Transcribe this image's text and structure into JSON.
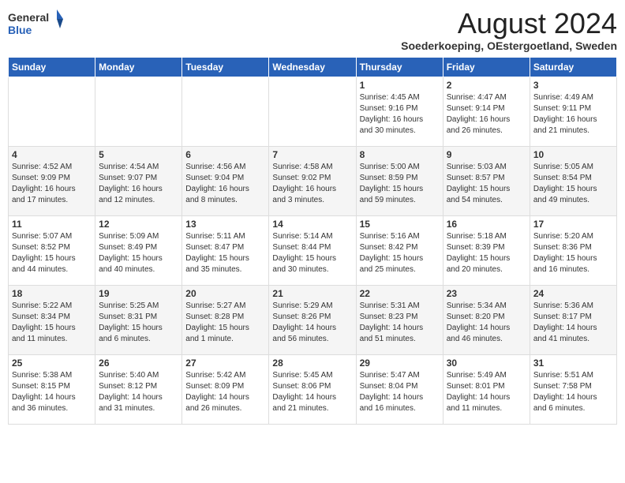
{
  "header": {
    "logo_general": "General",
    "logo_blue": "Blue",
    "title": "August 2024",
    "subtitle": "Soederkoeping, OEstergoetland, Sweden"
  },
  "days_of_week": [
    "Sunday",
    "Monday",
    "Tuesday",
    "Wednesday",
    "Thursday",
    "Friday",
    "Saturday"
  ],
  "weeks": [
    [
      {
        "num": "",
        "info": ""
      },
      {
        "num": "",
        "info": ""
      },
      {
        "num": "",
        "info": ""
      },
      {
        "num": "",
        "info": ""
      },
      {
        "num": "1",
        "info": "Sunrise: 4:45 AM\nSunset: 9:16 PM\nDaylight: 16 hours\nand 30 minutes."
      },
      {
        "num": "2",
        "info": "Sunrise: 4:47 AM\nSunset: 9:14 PM\nDaylight: 16 hours\nand 26 minutes."
      },
      {
        "num": "3",
        "info": "Sunrise: 4:49 AM\nSunset: 9:11 PM\nDaylight: 16 hours\nand 21 minutes."
      }
    ],
    [
      {
        "num": "4",
        "info": "Sunrise: 4:52 AM\nSunset: 9:09 PM\nDaylight: 16 hours\nand 17 minutes."
      },
      {
        "num": "5",
        "info": "Sunrise: 4:54 AM\nSunset: 9:07 PM\nDaylight: 16 hours\nand 12 minutes."
      },
      {
        "num": "6",
        "info": "Sunrise: 4:56 AM\nSunset: 9:04 PM\nDaylight: 16 hours\nand 8 minutes."
      },
      {
        "num": "7",
        "info": "Sunrise: 4:58 AM\nSunset: 9:02 PM\nDaylight: 16 hours\nand 3 minutes."
      },
      {
        "num": "8",
        "info": "Sunrise: 5:00 AM\nSunset: 8:59 PM\nDaylight: 15 hours\nand 59 minutes."
      },
      {
        "num": "9",
        "info": "Sunrise: 5:03 AM\nSunset: 8:57 PM\nDaylight: 15 hours\nand 54 minutes."
      },
      {
        "num": "10",
        "info": "Sunrise: 5:05 AM\nSunset: 8:54 PM\nDaylight: 15 hours\nand 49 minutes."
      }
    ],
    [
      {
        "num": "11",
        "info": "Sunrise: 5:07 AM\nSunset: 8:52 PM\nDaylight: 15 hours\nand 44 minutes."
      },
      {
        "num": "12",
        "info": "Sunrise: 5:09 AM\nSunset: 8:49 PM\nDaylight: 15 hours\nand 40 minutes."
      },
      {
        "num": "13",
        "info": "Sunrise: 5:11 AM\nSunset: 8:47 PM\nDaylight: 15 hours\nand 35 minutes."
      },
      {
        "num": "14",
        "info": "Sunrise: 5:14 AM\nSunset: 8:44 PM\nDaylight: 15 hours\nand 30 minutes."
      },
      {
        "num": "15",
        "info": "Sunrise: 5:16 AM\nSunset: 8:42 PM\nDaylight: 15 hours\nand 25 minutes."
      },
      {
        "num": "16",
        "info": "Sunrise: 5:18 AM\nSunset: 8:39 PM\nDaylight: 15 hours\nand 20 minutes."
      },
      {
        "num": "17",
        "info": "Sunrise: 5:20 AM\nSunset: 8:36 PM\nDaylight: 15 hours\nand 16 minutes."
      }
    ],
    [
      {
        "num": "18",
        "info": "Sunrise: 5:22 AM\nSunset: 8:34 PM\nDaylight: 15 hours\nand 11 minutes."
      },
      {
        "num": "19",
        "info": "Sunrise: 5:25 AM\nSunset: 8:31 PM\nDaylight: 15 hours\nand 6 minutes."
      },
      {
        "num": "20",
        "info": "Sunrise: 5:27 AM\nSunset: 8:28 PM\nDaylight: 15 hours\nand 1 minute."
      },
      {
        "num": "21",
        "info": "Sunrise: 5:29 AM\nSunset: 8:26 PM\nDaylight: 14 hours\nand 56 minutes."
      },
      {
        "num": "22",
        "info": "Sunrise: 5:31 AM\nSunset: 8:23 PM\nDaylight: 14 hours\nand 51 minutes."
      },
      {
        "num": "23",
        "info": "Sunrise: 5:34 AM\nSunset: 8:20 PM\nDaylight: 14 hours\nand 46 minutes."
      },
      {
        "num": "24",
        "info": "Sunrise: 5:36 AM\nSunset: 8:17 PM\nDaylight: 14 hours\nand 41 minutes."
      }
    ],
    [
      {
        "num": "25",
        "info": "Sunrise: 5:38 AM\nSunset: 8:15 PM\nDaylight: 14 hours\nand 36 minutes."
      },
      {
        "num": "26",
        "info": "Sunrise: 5:40 AM\nSunset: 8:12 PM\nDaylight: 14 hours\nand 31 minutes."
      },
      {
        "num": "27",
        "info": "Sunrise: 5:42 AM\nSunset: 8:09 PM\nDaylight: 14 hours\nand 26 minutes."
      },
      {
        "num": "28",
        "info": "Sunrise: 5:45 AM\nSunset: 8:06 PM\nDaylight: 14 hours\nand 21 minutes."
      },
      {
        "num": "29",
        "info": "Sunrise: 5:47 AM\nSunset: 8:04 PM\nDaylight: 14 hours\nand 16 minutes."
      },
      {
        "num": "30",
        "info": "Sunrise: 5:49 AM\nSunset: 8:01 PM\nDaylight: 14 hours\nand 11 minutes."
      },
      {
        "num": "31",
        "info": "Sunrise: 5:51 AM\nSunset: 7:58 PM\nDaylight: 14 hours\nand 6 minutes."
      }
    ]
  ]
}
